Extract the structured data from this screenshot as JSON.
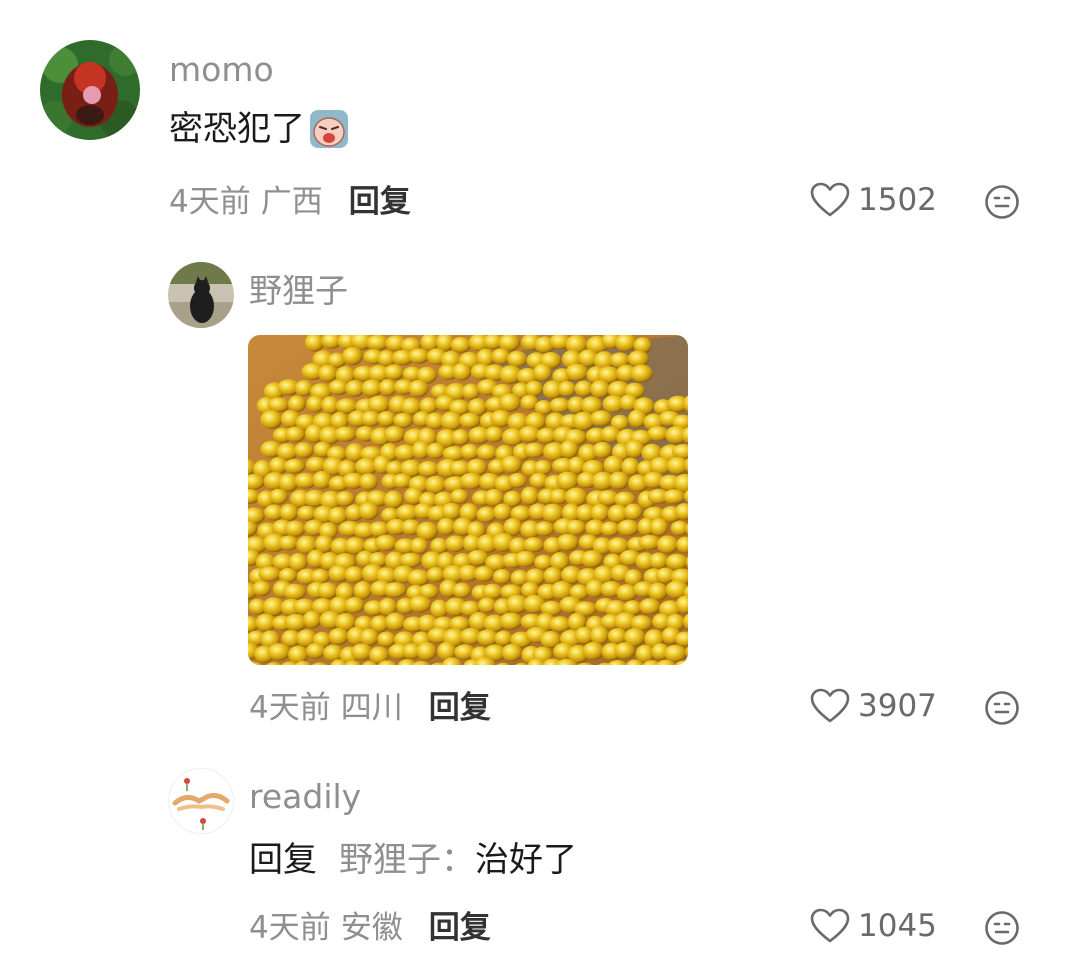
{
  "comments": [
    {
      "username": "momo",
      "text": "密恐犯了",
      "emoji_icon": "crying-face-sticker",
      "time": "4天前",
      "location": "广西",
      "reply_label": "回复",
      "likes": "1502"
    },
    {
      "username": "野狸子",
      "image_icon": "gold-beads-photo",
      "time": "4天前",
      "location": "四川",
      "reply_label": "回复",
      "likes": "3907"
    },
    {
      "username": "readily",
      "reply_prefix": "回复",
      "reply_target": "野狸子：",
      "text": "治好了",
      "time": "4天前",
      "location": "安徽",
      "reply_label": "回复",
      "likes": "1045"
    }
  ],
  "colors": {
    "secondary_text": "#8f8f8f",
    "primary_text": "#1a1a1a",
    "icon_gray": "#6a6a6a",
    "gold": "#d4a614"
  }
}
